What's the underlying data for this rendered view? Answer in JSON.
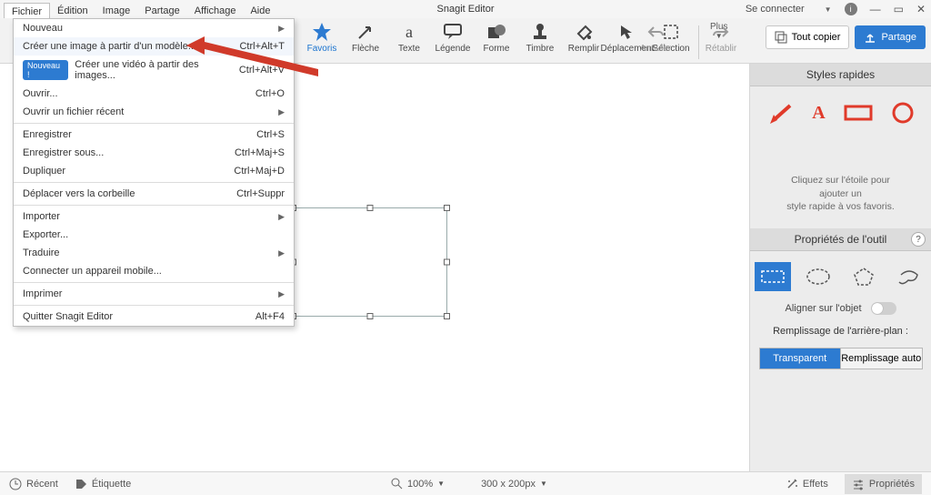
{
  "window": {
    "title": "Snagit Editor",
    "signin": "Se connecter",
    "min": "—",
    "max": "▭",
    "close": "✕"
  },
  "menubar": [
    "Fichier",
    "Édition",
    "Image",
    "Partage",
    "Affichage",
    "Aide"
  ],
  "file_menu": {
    "nouveau": "Nouveau",
    "template": "Créer une image à partir d'un modèle...",
    "template_sc": "Ctrl+Alt+T",
    "video": "Créer une vidéo à partir des images...",
    "video_sc": "Ctrl+Alt+V",
    "new_badge": "Nouveau !",
    "open": "Ouvrir...",
    "open_sc": "Ctrl+O",
    "recent": "Ouvrir un fichier récent",
    "save": "Enregistrer",
    "save_sc": "Ctrl+S",
    "saveas": "Enregistrer sous...",
    "saveas_sc": "Ctrl+Maj+S",
    "dup": "Dupliquer",
    "dup_sc": "Ctrl+Maj+D",
    "trash": "Déplacer vers la corbeille",
    "trash_sc": "Ctrl+Suppr",
    "import": "Importer",
    "export": "Exporter...",
    "translate": "Traduire",
    "connect": "Connecter un appareil mobile...",
    "print": "Imprimer",
    "quit": "Quitter Snagit Editor",
    "quit_sc": "Alt+F4"
  },
  "tools": {
    "favoris": "Favoris",
    "fleche": "Flèche",
    "texte": "Texte",
    "legende": "Légende",
    "forme": "Forme",
    "timbre": "Timbre",
    "remplir": "Remplir",
    "deplacement": "Déplacement",
    "selection": "Sélection",
    "plus": "Plus",
    "annuler": "Annuler",
    "retablir": "Rétablir"
  },
  "actions": {
    "copyall": "Tout copier",
    "share": "Partage"
  },
  "rpanel": {
    "qs_title": "Styles rapides",
    "qs_hint1": "Cliquez sur l'étoile pour",
    "qs_hint2": "ajouter un",
    "qs_hint3": "style rapide à vos favoris.",
    "props_title": "Propriétés de l'outil",
    "align": "Aligner sur l'objet",
    "fill_label": "Remplissage de l'arrière-plan :",
    "transparent": "Transparent",
    "autofill": "Remplissage auto"
  },
  "status": {
    "recent": "Récent",
    "tag": "Étiquette",
    "zoom": "100%",
    "dims": "300 x 200px",
    "effects": "Effets",
    "props": "Propriétés"
  }
}
